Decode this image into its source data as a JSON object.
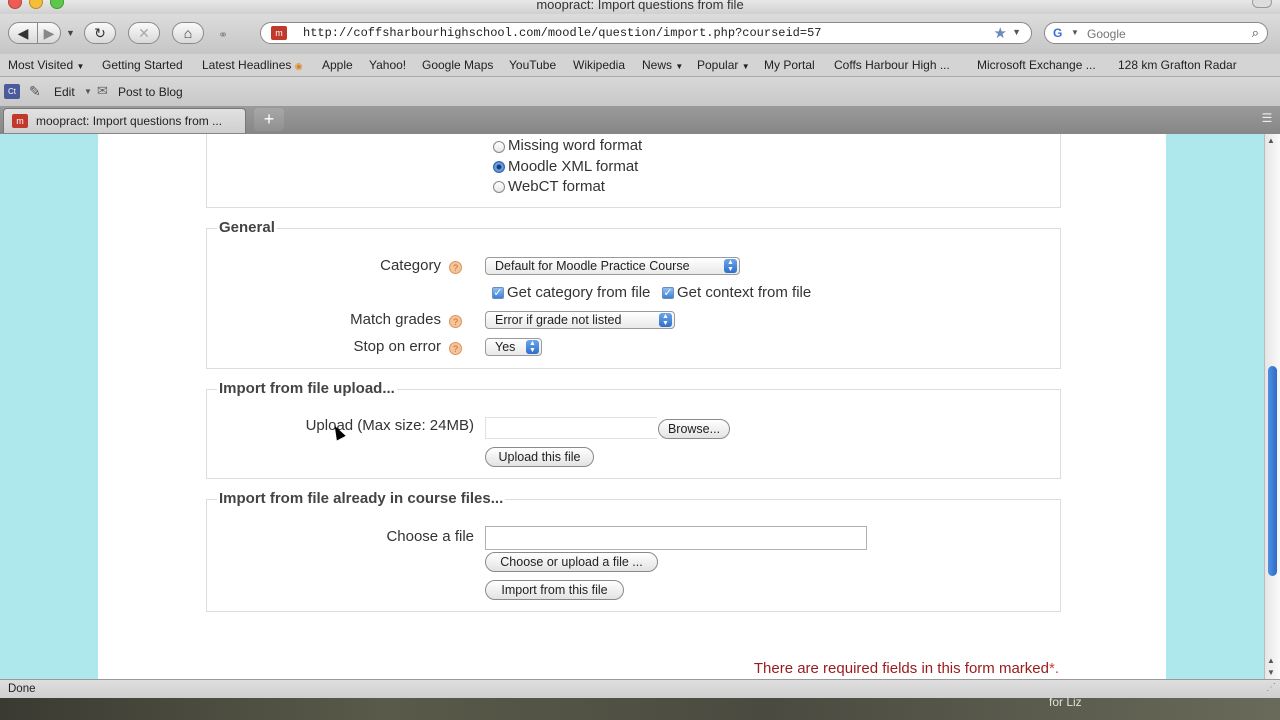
{
  "window": {
    "title": "moopract: Import questions from file"
  },
  "nav": {
    "url": "http://coffsharbourhighschool.com/moodle/question/import.php?courseid=57",
    "search_placeholder": "Google"
  },
  "bookmarks": [
    "Most Visited",
    "Getting Started",
    "Latest Headlines",
    "Apple",
    "Yahoo!",
    "Google Maps",
    "YouTube",
    "Wikipedia",
    "News",
    "Popular",
    "My Portal",
    "Coffs Harbour High ...",
    "Microsoft Exchange ...",
    "128 km Grafton Radar"
  ],
  "toolbar": {
    "ct_label": "Ct",
    "edit_label": "Edit",
    "post_label": "Post to Blog"
  },
  "tab": {
    "label": "moopract: Import questions from ...",
    "newtab_label": "+"
  },
  "file_format": {
    "options": [
      {
        "label": "Missing word format",
        "selected": false
      },
      {
        "label": "Moodle XML format",
        "selected": true
      },
      {
        "label": "WebCT format",
        "selected": false
      }
    ]
  },
  "general": {
    "legend": "General",
    "category_label": "Category",
    "category_value": "Default for Moodle Practice Course",
    "get_category_label": "Get category from file",
    "get_context_label": "Get context from file",
    "match_grades_label": "Match grades",
    "match_grades_value": "Error if grade not listed",
    "stop_on_error_label": "Stop on error",
    "stop_on_error_value": "Yes"
  },
  "upload": {
    "legend": "Import from file upload...",
    "label": "Upload (Max size: 24MB)",
    "browse_label": "Browse...",
    "upload_button": "Upload this file"
  },
  "course_files": {
    "legend": "Import from file already in course files...",
    "label": "Choose a file",
    "choose_button": "Choose or upload a file ...",
    "import_button": "Import from this file"
  },
  "required_note": {
    "text": "There are required fields in this form marked",
    "marker": "*."
  },
  "status": {
    "text": "Done"
  },
  "desktop_caption": "for Liz",
  "colors": {
    "page_bg": "#aee8ec",
    "required_text": "#9a1b1b",
    "accent": "#3d7fd1"
  }
}
